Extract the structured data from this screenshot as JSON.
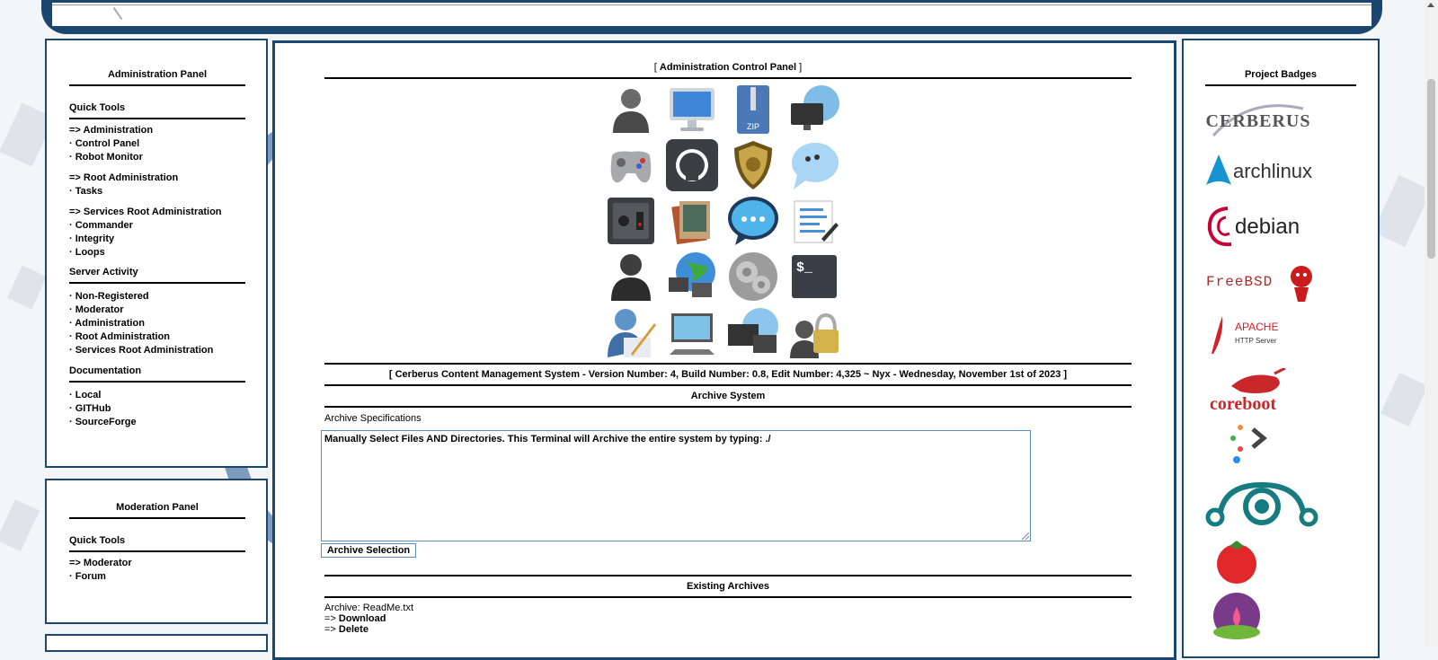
{
  "admin_panel": {
    "title": "Administration Panel",
    "quick_tools": "Quick Tools",
    "groups": [
      {
        "head": "=> Administration",
        "items": [
          "· Control Panel",
          "· Robot Monitor"
        ]
      },
      {
        "head": "=> Root Administration",
        "items": [
          "· Tasks"
        ]
      },
      {
        "head": "=> Services Root Administration",
        "items": [
          "· Commander",
          "· Integrity",
          "· Loops"
        ]
      }
    ],
    "server_activity": "Server Activity",
    "activity_items": [
      "· Non-Registered",
      "· Moderator",
      "· Administration",
      "· Root Administration",
      "· Services Root Administration"
    ],
    "documentation": "Documentation",
    "doc_items": [
      "· Local",
      "· GITHub",
      "· SourceForge"
    ]
  },
  "mod_panel": {
    "title": "Moderation Panel",
    "quick_tools": "Quick Tools",
    "head": "=> Moderator",
    "items": [
      "· Forum"
    ]
  },
  "center": {
    "title_open": "[",
    "title": "Administration Control Panel",
    "title_close": "]",
    "version_line": "[ Cerberus Content Management System - Version Number: 4, Build Number: 0.8, Edit Number: 4,325 ~ Nyx - Wednesday, November 1st of 2023 ]",
    "archive_system": "Archive System",
    "archive_spec_label": "Archive Specifications",
    "archive_text": "Manually Select Files AND Directories. This Terminal will Archive the entire system by typing: ./",
    "archive_button": "Archive Selection",
    "existing_archives": "Existing Archives",
    "archive_file": "Archive: ReadMe.txt",
    "download": "Download",
    "delete": "Delete",
    "arrow": "=>"
  },
  "icon_grid": [
    "user-icon",
    "monitor-icon",
    "zip-archive-icon",
    "network-monitor-icon",
    "gamepad-icon",
    "github-icon",
    "security-badge-icon",
    "chat-bubble-icon",
    "power-switch-icon",
    "photos-icon",
    "messages-icon",
    "text-editor-icon",
    "user-dark-icon",
    "network-globe-icon",
    "settings-gear-icon",
    "terminal-icon",
    "user-edit-icon",
    "display-settings-icon",
    "remote-desktop-icon",
    "user-lock-icon"
  ],
  "right_panel": {
    "title": "Project Badges",
    "badges": [
      {
        "name": "cerberus-badge",
        "text": "CERBERUS"
      },
      {
        "name": "archlinux-badge",
        "text": "archlinux"
      },
      {
        "name": "debian-badge",
        "text": "debian"
      },
      {
        "name": "freebsd-badge",
        "text": "FreeBSD"
      },
      {
        "name": "apache-badge",
        "text": "APACHE",
        "sub": "HTTP Server"
      },
      {
        "name": "coreboot-badge",
        "text": "coreboot"
      },
      {
        "name": "arrow-logo-badge",
        "text": ""
      },
      {
        "name": "lineageos-badge",
        "text": ""
      },
      {
        "name": "tomato-badge",
        "text": ""
      },
      {
        "name": "lotus-badge",
        "text": ""
      }
    ]
  },
  "colors": {
    "frame": "#1a4670",
    "terminal": "#3a3f47"
  }
}
